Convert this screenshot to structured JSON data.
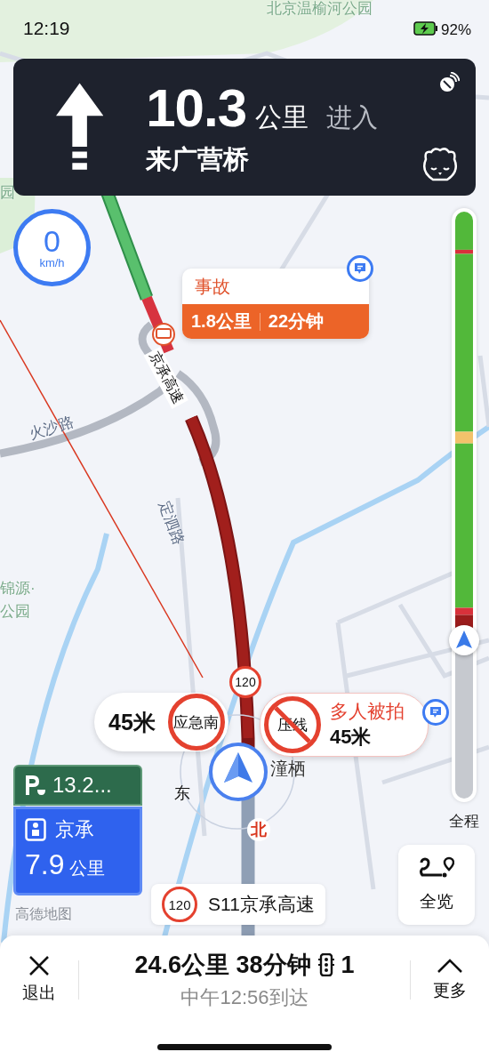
{
  "status_bar": {
    "time": "12:19",
    "battery": "92%"
  },
  "guidance": {
    "distance": "10.3",
    "unit": "公里",
    "action": "进入",
    "road": "来广营桥"
  },
  "speed": {
    "value": "0",
    "unit": "km/h"
  },
  "map_labels": [
    {
      "text": "北京温榆河公园",
      "kind": "park"
    },
    {
      "text": "园",
      "kind": "park"
    },
    {
      "text": "火沙路",
      "kind": "road"
    },
    {
      "text": "定泗路",
      "kind": "road"
    },
    {
      "text": "京承高速",
      "kind": "route"
    },
    {
      "text": "锦源·",
      "kind": "park"
    },
    {
      "text": "公园",
      "kind": "park"
    },
    {
      "text": "潼栖",
      "kind": "place"
    }
  ],
  "incident": {
    "title": "事故",
    "distance": "1.8公里",
    "duration": "22分钟"
  },
  "traffic_bar": {
    "level": 0.27,
    "label": "全程"
  },
  "speed_limit": "120",
  "alerts": [
    {
      "kind": "lane",
      "distance": "45米",
      "sign": "应急南"
    },
    {
      "kind": "camera",
      "title": "多人被拍",
      "distance": "45米",
      "sign": "压线"
    }
  ],
  "compass": {
    "east": "东",
    "north": "北"
  },
  "signs": {
    "service": {
      "distance": "13.2..."
    },
    "exit": {
      "name": "京承",
      "distance": "7.9",
      "unit": "公里"
    }
  },
  "logo": "高德地图",
  "current_road": {
    "speed_limit": "120",
    "name": "S11京承高速"
  },
  "overview": {
    "label": "全览"
  },
  "bottom": {
    "exit": "退出",
    "summary": "24.6公里 38分钟",
    "lights": "1",
    "arrival": "中午12:56到达",
    "more": "更多"
  }
}
